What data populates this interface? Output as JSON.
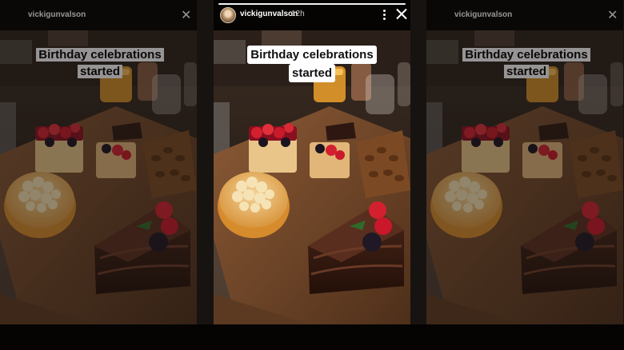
{
  "story": {
    "username": "vickigunvalson",
    "timestamp": "12h",
    "caption_line1": "Birthday celebrations",
    "caption_line2": "started"
  },
  "icons": {
    "more": "more-options-icon",
    "close": "close-icon",
    "avatar": "profile-avatar"
  },
  "colors": {
    "board": "#7a4e2e",
    "cheesecake": "#e7b04e",
    "chocolate": "#3b1e14",
    "strawberry": "#c8102e"
  }
}
